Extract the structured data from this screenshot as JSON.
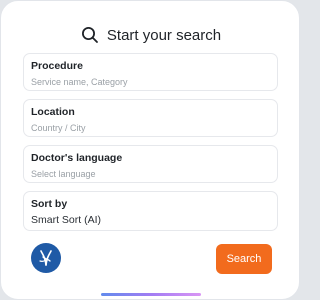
{
  "header": {
    "title": "Start your search",
    "icon": "search-icon"
  },
  "fields": {
    "procedure": {
      "label": "Procedure",
      "placeholder": "Service name, Category"
    },
    "location": {
      "label": "Location",
      "placeholder": "Country / City"
    },
    "language": {
      "label": "Doctor's language",
      "placeholder": "Select language"
    },
    "sort": {
      "label": "Sort by",
      "value": "Smart Sort (AI)"
    }
  },
  "footer": {
    "logo_icon": "brand-logo-icon",
    "search_label": "Search"
  },
  "colors": {
    "accent": "#f26b1d",
    "logo_bg": "#1f5aa6"
  }
}
